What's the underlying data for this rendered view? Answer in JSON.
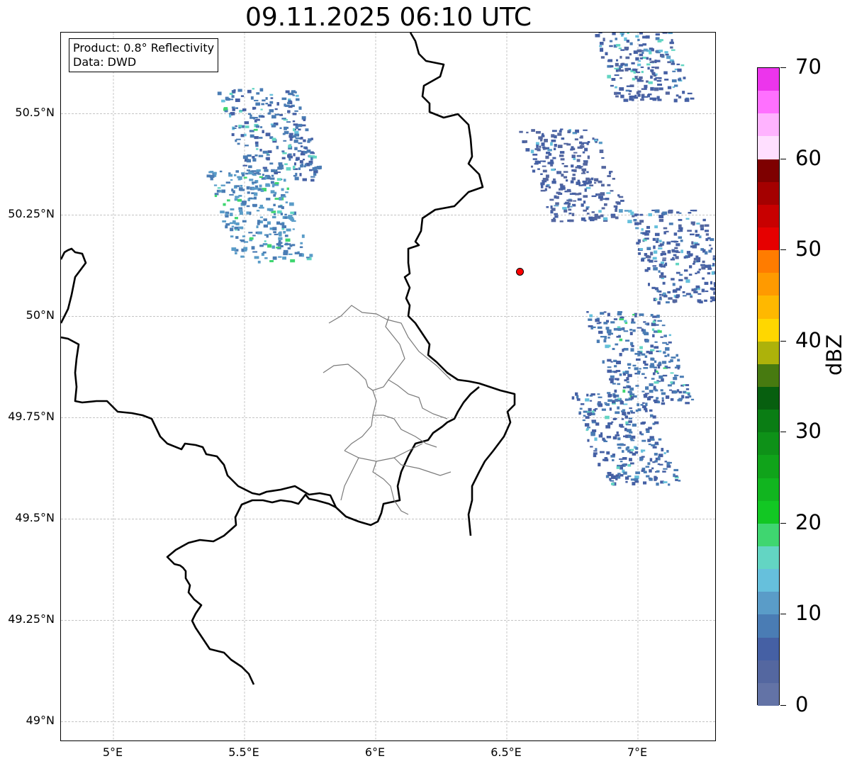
{
  "title": "09.11.2025 06:10 UTC",
  "info": {
    "product": "Product: 0.8° Reflectivity",
    "data": "Data: DWD"
  },
  "axes": {
    "lat_labels": [
      "50.5°N",
      "50.25°N",
      "50°N",
      "49.75°N",
      "49.5°N",
      "49.25°N",
      "49°N"
    ],
    "lon_labels": [
      "5°E",
      "5.5°E",
      "6°E",
      "6.5°E",
      "7°E"
    ],
    "lat_values": [
      50.5,
      50.25,
      50.0,
      49.75,
      49.5,
      49.25,
      49.0
    ],
    "lon_values": [
      5.0,
      5.5,
      6.0,
      6.5,
      7.0
    ],
    "lon_range": [
      4.8,
      7.3
    ],
    "lat_range": [
      48.95,
      50.7
    ],
    "grid": true
  },
  "colorbar": {
    "unit": "dBZ",
    "ticks": [
      "0",
      "10",
      "20",
      "30",
      "40",
      "50",
      "60",
      "70"
    ],
    "tick_values": [
      0,
      10,
      20,
      30,
      40,
      50,
      60,
      70
    ],
    "range": [
      0,
      70
    ],
    "colors": [
      "#6373a6",
      "#5467a0",
      "#4560a4",
      "#4a7cb4",
      "#5a9cc8",
      "#66c0dc",
      "#63d5c3",
      "#3fd670",
      "#12c723",
      "#11b51f",
      "#10a31a",
      "#0e9118",
      "#0a7d14",
      "#075f0f",
      "#477a10",
      "#adb20a",
      "#ffd700",
      "#ffb800",
      "#ff9a00",
      "#ff7c00",
      "#e60000",
      "#c80000",
      "#a40000",
      "#7e0000",
      "#ffdfff",
      "#ffb3ff",
      "#ff70ff",
      "#ec35ec"
    ]
  },
  "marker": {
    "lon": 6.55,
    "lat": 50.11,
    "color": "#ff0000"
  },
  "echo_regions": [
    {
      "lon": 5.6,
      "lat": 50.45,
      "dbz": 8
    },
    {
      "lon": 5.55,
      "lat": 50.25,
      "dbz": 10
    },
    {
      "lon": 7.0,
      "lat": 50.65,
      "dbz": 6
    },
    {
      "lon": 6.75,
      "lat": 50.35,
      "dbz": 5
    },
    {
      "lon": 7.15,
      "lat": 50.15,
      "dbz": 6
    },
    {
      "lon": 7.0,
      "lat": 49.9,
      "dbz": 8
    },
    {
      "lon": 6.95,
      "lat": 49.7,
      "dbz": 7
    }
  ]
}
